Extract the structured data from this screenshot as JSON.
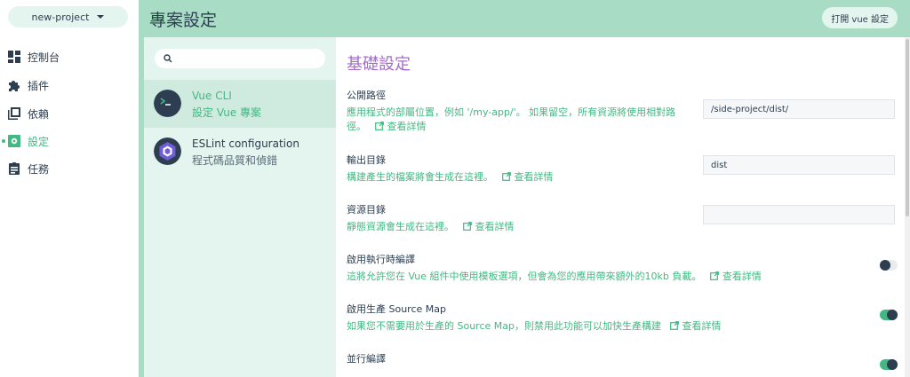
{
  "nav": {
    "project": "new-project",
    "items": [
      {
        "label": "控制台",
        "icon": "dashboard-icon"
      },
      {
        "label": "插件",
        "icon": "puzzle-icon"
      },
      {
        "label": "依賴",
        "icon": "library-icon"
      },
      {
        "label": "設定",
        "icon": "settings-icon"
      },
      {
        "label": "任務",
        "icon": "assignment-icon"
      }
    ],
    "active_index": 3
  },
  "header": {
    "title": "專案設定",
    "open_button": "打開 vue 設定"
  },
  "search": {
    "placeholder": "",
    "value": ""
  },
  "plugins": [
    {
      "name": "Vue CLI",
      "description": "設定 Vue 專案",
      "icon": "vue-cli-logo"
    },
    {
      "name": "ESLint configuration",
      "description": "程式碼品質和偵錯",
      "icon": "eslint-logo"
    }
  ],
  "config": {
    "section_title": "基礎設定",
    "rows": [
      {
        "label": "公開路徑",
        "help": "應用程式的部屬位置，例如 '/my-app/'。 如果留空，所有資源將使用相對路徑。",
        "more": "查看詳情",
        "value": "/side-project/dist/"
      },
      {
        "label": "輸出目錄",
        "help": "構建產生的檔案將會生成在這裡。",
        "more": "查看詳情",
        "value": "dist"
      },
      {
        "label": "資源目錄",
        "help": "靜態資源會生成在這裡。",
        "more": "查看詳情",
        "value": ""
      },
      {
        "label": "啟用執行時編譯",
        "help": "這將允許您在 Vue 組件中使用模板選項，但會為您的應用帶來額外的10kb 負載。",
        "more": "查看詳情",
        "toggle": false
      },
      {
        "label": "啟用生產 Source Map",
        "help": "如果您不需要用於生產的 Source Map，則禁用此功能可以加快生產構建",
        "more": "查看詳情",
        "toggle": true
      },
      {
        "label": "並行編譯",
        "help": "",
        "more": "",
        "toggle": true
      }
    ]
  },
  "colors": {
    "accent": "#42b983",
    "header_bg": "#a9dcc5",
    "list_bg": "#e4f5ef",
    "title_purple": "#a36bc7",
    "dark": "#2c3e50"
  }
}
